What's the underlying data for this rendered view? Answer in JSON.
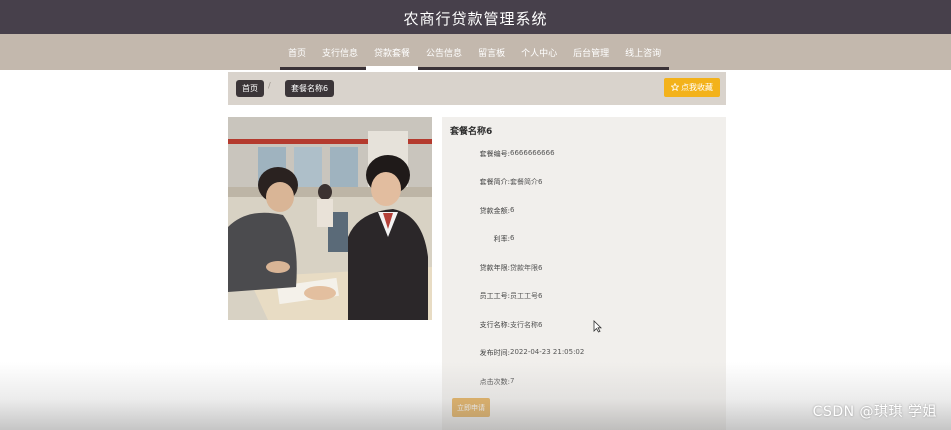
{
  "header": {
    "title": "农商行贷款管理系统"
  },
  "nav": {
    "items": [
      {
        "label": "首页"
      },
      {
        "label": "支行信息"
      },
      {
        "label": "贷款套餐",
        "active": true
      },
      {
        "label": "公告信息"
      },
      {
        "label": "留言板"
      },
      {
        "label": "个人中心"
      },
      {
        "label": "后台管理"
      },
      {
        "label": "线上咨询"
      }
    ]
  },
  "breadcrumb": {
    "home": "首页",
    "separator": "/",
    "current": "套餐名称6",
    "favorite_label": "点我收藏",
    "favorite_icon": "star-icon"
  },
  "detail": {
    "title": "套餐名称6",
    "fields": [
      {
        "label": "套餐编号:",
        "value": "6666666666"
      },
      {
        "label": "套餐简介:",
        "value": "套餐简介6"
      },
      {
        "label": "贷款金额:",
        "value": "6"
      },
      {
        "label": "利率:",
        "value": "6"
      },
      {
        "label": "贷款年限:",
        "value": "贷款年限6"
      },
      {
        "label": "员工工号:",
        "value": "员工工号6"
      },
      {
        "label": "支行名称:",
        "value": "支行名称6"
      },
      {
        "label": "发布时间:",
        "value": "2022-04-23 21:05:02"
      },
      {
        "label": "点击次数:",
        "value": "7"
      }
    ],
    "apply_label": "立即申请"
  },
  "watermark": "CSDN @琪琪 学姐",
  "colors": {
    "header_bg": "#47404b",
    "nav_bg": "#c3b8ad",
    "favorite_button": "#f3b21b",
    "apply_button": "#e0a03a",
    "panel_bg": "#f1efec"
  }
}
